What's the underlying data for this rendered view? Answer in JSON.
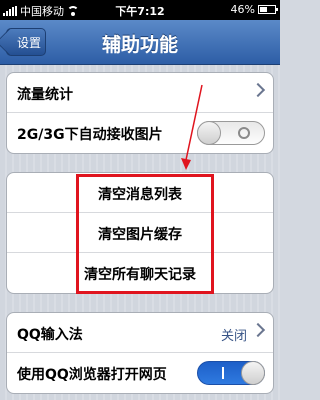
{
  "status_bar": {
    "carrier": "中国移动",
    "time": "下午7:12",
    "battery_percent": "46%"
  },
  "nav": {
    "back_label": "设置",
    "title": "辅助功能"
  },
  "group1": {
    "traffic_stats": "流量统计",
    "auto_receive_images": "2G/3G下自动接收图片",
    "auto_receive_enabled": false
  },
  "group2": {
    "clear_message_list": "清空消息列表",
    "clear_image_cache": "清空图片缓存",
    "clear_all_chat_history": "清空所有聊天记录"
  },
  "group3": {
    "qq_input_method": "QQ输入法",
    "qq_input_method_value": "关闭",
    "use_qq_browser": "使用QQ浏览器打开网页",
    "use_qq_browser_enabled": true
  },
  "colors": {
    "nav_bar": "#2d5ea6",
    "annotation": "#e0141e",
    "toggle_on": "#2f7ae0"
  }
}
